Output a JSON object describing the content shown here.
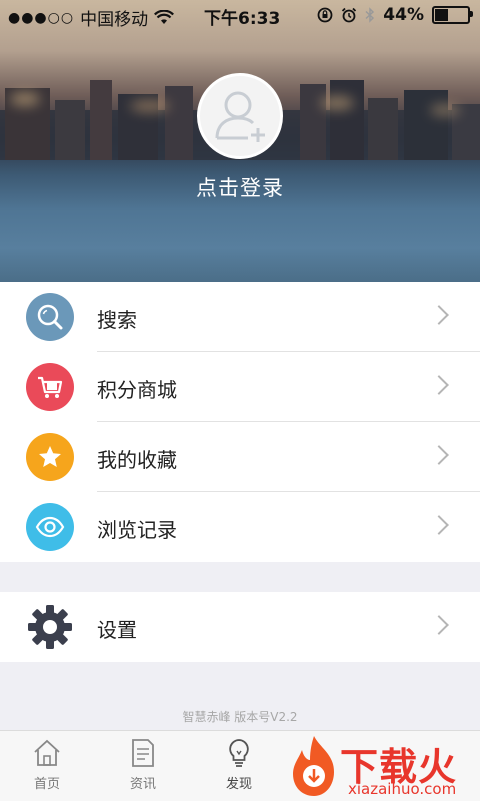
{
  "status_bar": {
    "signal": "●●●○○",
    "carrier": "中国移动",
    "time": "下午6:33",
    "battery": "44%"
  },
  "profile": {
    "login_label": "点击登录"
  },
  "menu": {
    "items": [
      {
        "label": "搜索",
        "icon": "search-icon",
        "color": "#6b98b9"
      },
      {
        "label": "积分商城",
        "icon": "cart-icon",
        "color": "#ea4a59"
      },
      {
        "label": "我的收藏",
        "icon": "star-icon",
        "color": "#f6a51c"
      },
      {
        "label": "浏览记录",
        "icon": "eye-icon",
        "color": "#3fbde8"
      }
    ]
  },
  "settings": {
    "label": "设置",
    "icon": "gear-icon",
    "color": "#3b3f4d"
  },
  "footer": {
    "version_text": "智慧赤峰  版本号V2.2"
  },
  "tabbar": {
    "items": [
      {
        "label": "首页",
        "icon": "home-icon"
      },
      {
        "label": "资讯",
        "icon": "news-icon"
      },
      {
        "label": "发现",
        "icon": "bulb-icon",
        "active": true
      }
    ]
  },
  "watermark": {
    "title": "下载火",
    "url": "xiazaihuo.com"
  }
}
